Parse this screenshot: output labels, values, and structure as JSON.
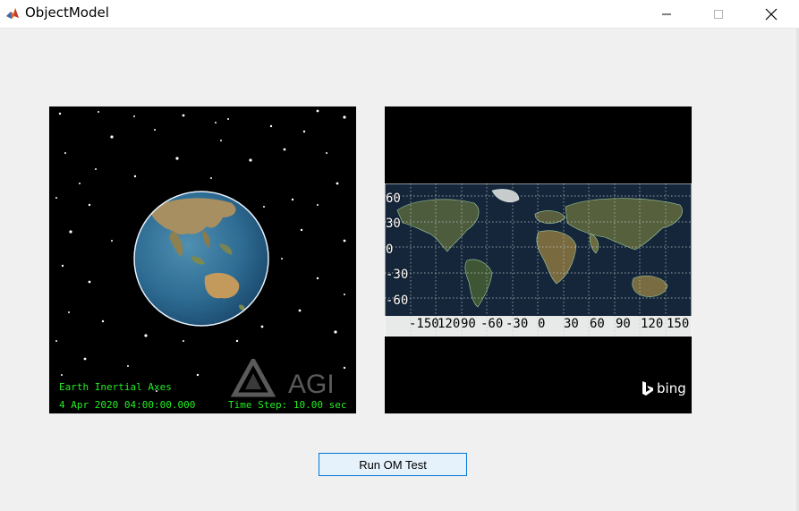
{
  "window": {
    "title": "ObjectModel",
    "icon": "matlab-icon",
    "controls": [
      "minimize-icon",
      "maximize-icon",
      "close-icon"
    ]
  },
  "globe_view": {
    "overlay_line1": "Earth Inertial Axes",
    "overlay_date": "4 Apr 2020 04:00:00.000",
    "overlay_timestep": "Time Step: 10.00 sec",
    "logo_text": "AGI",
    "text_color": "#22ee22"
  },
  "map_view": {
    "latitude_labels": [
      "60",
      "30",
      "0",
      "-30",
      "-60"
    ],
    "longitude_labels": [
      "-150",
      "120",
      "90",
      "-60",
      "-30",
      "0",
      "30",
      "60",
      "90",
      "120",
      "150"
    ],
    "provider_logo": "bing"
  },
  "controls": {
    "run_button": "Run OM Test"
  }
}
